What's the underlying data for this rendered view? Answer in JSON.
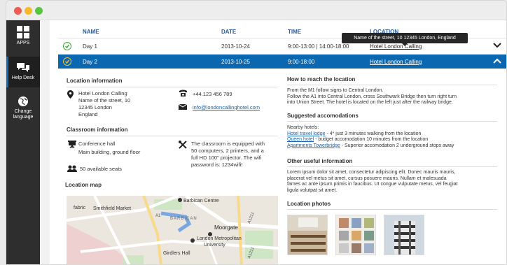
{
  "sidebar": {
    "items": [
      {
        "label": "APPS",
        "icon": "apps-grid-icon"
      },
      {
        "label": "Help Desk",
        "icon": "chat-bubbles-icon"
      },
      {
        "label": "Change language",
        "icon": "globe-icon"
      }
    ]
  },
  "table": {
    "headers": {
      "name": "NAME",
      "date": "DATE",
      "time": "TIME",
      "location": "LOCATION"
    },
    "rows": [
      {
        "name": "Day 1",
        "date": "2013-10-24",
        "time": "9:00-13:00 | 14:00-18:00",
        "location": "Hotel London Calling"
      },
      {
        "name": "Day 2",
        "date": "2013-10-25",
        "time": "9:00-18:00",
        "location": "Hotel London Calling"
      }
    ],
    "tooltip": "Name of the street, 10 12345 London, England"
  },
  "location_info": {
    "title": "Location information",
    "hotel_name": "Hotel London Calling",
    "address_line1": "Name of the street, 10",
    "address_line2": "12345 London",
    "address_line3": "England",
    "phone": "+44.123 456 789",
    "email": "info@londoncallinghotel.com"
  },
  "classroom": {
    "title": "Classroom information",
    "room_line1": "Conference hall",
    "room_line2": "Main building, ground floor",
    "equipment_line1": "The classroom is equipped with",
    "equipment_line2": "50 computers, 2 printers, and a",
    "equipment_line3": "full HD 100\" projector. The wifi",
    "equipment_line4": "password is: 1234wifi!",
    "seats": "50 available seats"
  },
  "map": {
    "title": "Location map",
    "labels": {
      "barbican_centre": "Barbican Centre",
      "smithfield": "Smithfield Market",
      "fabric": "fabric",
      "barbican": "BARBICAN",
      "moorgate": "Moorgate",
      "london_met": "London Metropolitan",
      "university": "University",
      "girdlers": "Girdlers Hall",
      "a1": "A1",
      "a1211": "A1211",
      "a1211b": "A1211"
    }
  },
  "how_to_reach": {
    "title": "How to reach the location",
    "line1": "From the M1 follow signs to Central London.",
    "line2": "Follow the A1 into Central London, cross Southwark Bridge then turn right turn",
    "line3": "into Union Street. The hotel is located on the left just after the railway bridge."
  },
  "accommodations": {
    "title": "Suggested accomodations",
    "intro": "Nearby hotels:",
    "hotels": [
      {
        "name": "Hotel travel lodge",
        "desc": " - 4* just 3 minutes walking from the location"
      },
      {
        "name": "Queen hotel",
        "desc": " - budget accomodation 10 minutes from the location"
      },
      {
        "name": "Apartments Towerbridge",
        "desc": " - Superior accomodation 2 underground stops away"
      }
    ]
  },
  "other_info": {
    "title": "Other useful information",
    "line1": "Lorem ipsum dolor sit amet, consectetur adipiscing elit. Donec mauris mauris,",
    "line2": "placerat vel metus sit amet, cursus posuere mauris. Nullam et malesuada",
    "line3": "fames ac ante ipsum primis in faucibus. Ut congue vulputate metus, vel feugiat",
    "line4": "ligula volutpat sit amet."
  },
  "photos": {
    "title": "Location photos"
  },
  "colors": {
    "accent": "#0c67b1",
    "sidebar": "#2e2e2e",
    "header_text": "#2a5d9e",
    "link": "#1864b0"
  }
}
